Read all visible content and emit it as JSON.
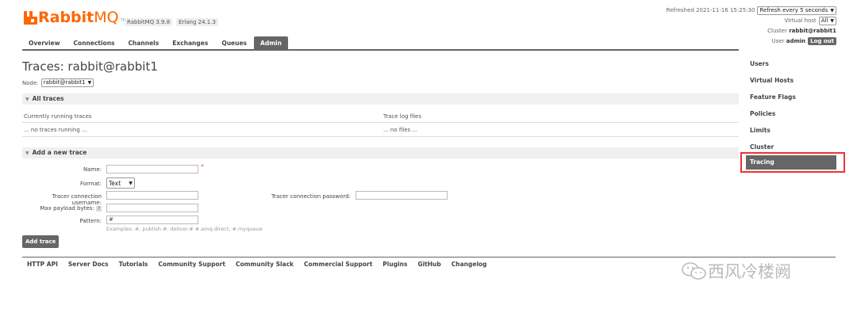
{
  "header": {
    "logo": "RabbitMQ",
    "logo_part1": "Rabbit",
    "logo_part2": "MQ",
    "tm": "TM",
    "rabbitmq_version": "RabbitMQ 3.9.8",
    "erlang_version": "Erlang 24.1.3"
  },
  "nav": [
    "Overview",
    "Connections",
    "Channels",
    "Exchanges",
    "Queues",
    "Admin"
  ],
  "nav_active": "Admin",
  "topright": {
    "refreshed": "Refreshed 2021-11-16 15:25:30",
    "refresh_select": "Refresh every 5 seconds",
    "vhost_label": "Virtual host",
    "vhost_select": "All",
    "cluster_label": "Cluster",
    "cluster_value": "rabbit@rabbit1",
    "user_label": "User",
    "user_value": "admin",
    "logout": "Log out"
  },
  "sidemenu": [
    "Users",
    "Virtual Hosts",
    "Feature Flags",
    "Policies",
    "Limits",
    "Cluster",
    "Tracing"
  ],
  "sidemenu_active": "Tracing",
  "page": {
    "title": "Traces: rabbit@rabbit1",
    "node_label": "Node:",
    "node_select": "rabbit@rabbit1"
  },
  "all_traces": {
    "heading": "All traces",
    "col_running": "Currently running traces",
    "col_files": "Trace log files",
    "running_empty": "... no traces running ...",
    "files_empty": "... no files ..."
  },
  "add_trace": {
    "heading": "Add a new trace",
    "name_label": "Name:",
    "required_mark": "*",
    "format_label": "Format:",
    "format_select": "Text",
    "username_label": "Tracer connection username:",
    "password_label": "Tracer connection password:",
    "max_payload_label": "Max payload bytes:",
    "max_payload_help": "?",
    "pattern_label": "Pattern:",
    "pattern_value": "#",
    "pattern_examples": "Examples: #, publish.#, deliver.# #.amq.direct, #.myqueue",
    "button": "Add trace"
  },
  "footer": [
    "HTTP API",
    "Server Docs",
    "Tutorials",
    "Community Support",
    "Community Slack",
    "Commercial Support",
    "Plugins",
    "GitHub",
    "Changelog"
  ],
  "watermark": "西风冷楼阙"
}
